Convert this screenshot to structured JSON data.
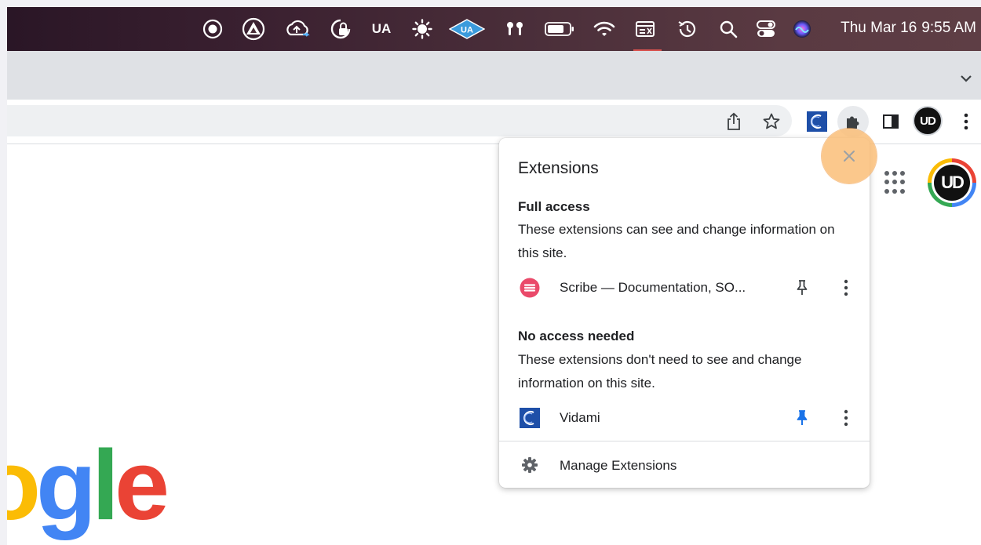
{
  "menubar": {
    "icons": [
      "record-icon",
      "triangle-app-icon",
      "cloud-sync-icon",
      "lock-dial-icon",
      "ua-icon",
      "brightness-icon",
      "ua-diamond-icon",
      "airpods-icon",
      "battery-icon",
      "wifi-icon",
      "display-icon",
      "time-machine-icon",
      "search-icon",
      "control-center-icon",
      "siri-icon"
    ],
    "ua_label": "UA",
    "date": "Thu Mar 16",
    "time": "9:55 AM"
  },
  "toolbar": {
    "icons": [
      "share-icon",
      "bookmark-star-icon",
      "vidami-extension-icon",
      "extensions-puzzle-icon",
      "side-panel-icon",
      "profile-avatar",
      "browser-menu-icon"
    ],
    "avatar_text": "UD"
  },
  "page": {
    "logo_text": "ogle",
    "avatar_text": "UD",
    "colors": {
      "blue": "#4285f4",
      "red": "#ea4335",
      "yellow": "#fbbc05",
      "green": "#34a853"
    }
  },
  "extensions_popup": {
    "title": "Extensions",
    "full_access": {
      "heading": "Full access",
      "description": "These extensions can see and change information on this site.",
      "items": [
        {
          "name": "Scribe — Documentation, SO...",
          "pinned": false,
          "icon": "scribe-icon"
        }
      ]
    },
    "no_access": {
      "heading": "No access needed",
      "description": "These extensions don't need to see and change information on this site.",
      "items": [
        {
          "name": "Vidami",
          "pinned": true,
          "icon": "vidami-icon"
        }
      ]
    },
    "manage_label": "Manage Extensions",
    "close_label": "×",
    "pin_active_color": "#1a73e8",
    "highlight_color": "#fbbf80"
  }
}
